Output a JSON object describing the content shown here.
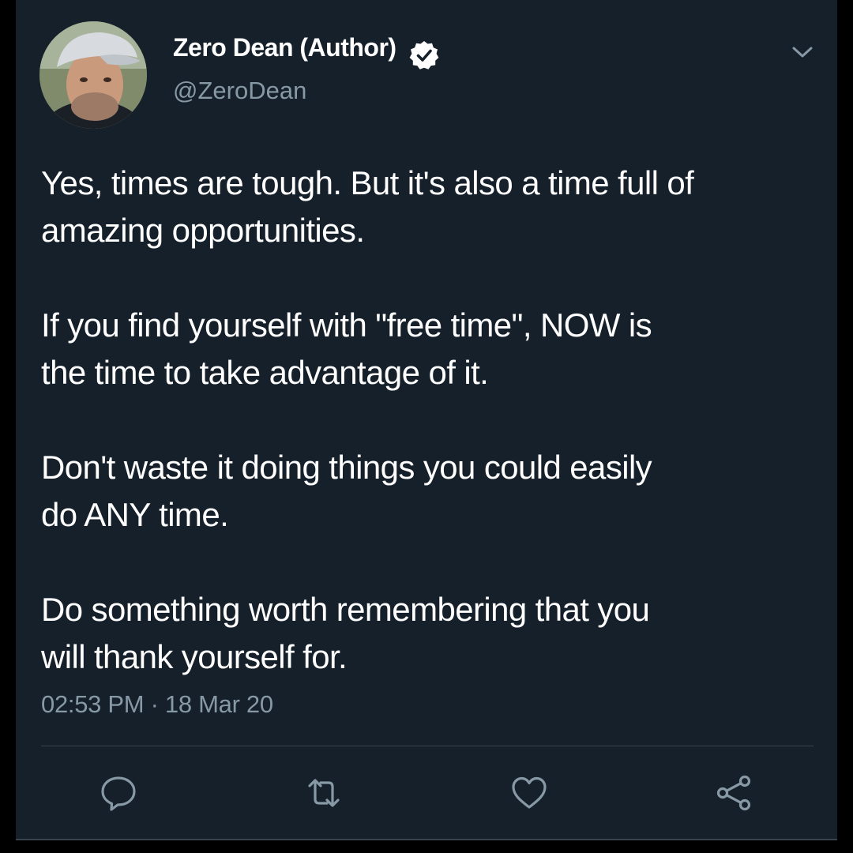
{
  "author": {
    "display_name": "Zero Dean (Author)",
    "handle": "@ZeroDean",
    "verified": true,
    "avatar_icon": "avatar-photo"
  },
  "tweet": {
    "paragraphs": [
      [
        "Yes, times are tough. But it's also a time full of",
        "amazing opportunities."
      ],
      [
        "If you find yourself with \"free time\", NOW is",
        "the time to take advantage of it."
      ],
      [
        "Don't waste it doing things you could easily",
        "do ANY time."
      ],
      [
        "Do something worth remembering that you",
        "will thank yourself for."
      ]
    ],
    "timestamp": "02:53 PM · 18 Mar 20"
  },
  "actions": [
    "reply-icon",
    "retweet-icon",
    "like-icon",
    "share-icon"
  ],
  "colors": {
    "background": "#15202b",
    "text": "#ffffff",
    "secondary_text": "#8899a6",
    "divider": "#38444d"
  }
}
